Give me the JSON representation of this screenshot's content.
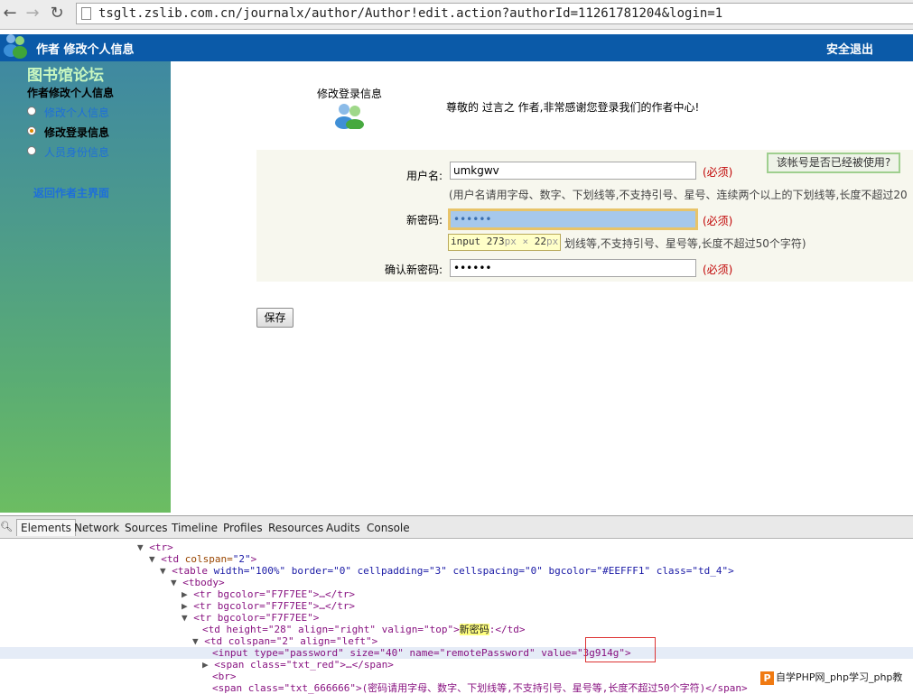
{
  "browser": {
    "url": "tsglt.zslib.com.cn/journalx/author/Author!edit.action?authorId=11261781204&login=1"
  },
  "header": {
    "title": "作者  修改个人信息",
    "logout": "安全退出",
    "bg_color": "#0b5aa8"
  },
  "sidebar": {
    "brand": "图书馆论坛",
    "heading": "作者修改个人信息",
    "items": [
      {
        "label": "修改个人信息",
        "selected": false
      },
      {
        "label": "修改登录信息",
        "selected": true
      },
      {
        "label": "人员身份信息",
        "selected": false
      }
    ],
    "back_link": "返回作者主界面"
  },
  "main": {
    "title": "修改登录信息",
    "welcome": "尊敬的 过言之 作者,非常感谢您登录我们的作者中心!"
  },
  "form": {
    "username_label": "用户名:",
    "username_value": "umkgwv",
    "username_hint": "(用户名请用字母、数字、下划线等,不支持引号、星号、连续两个以上的下划线等,长度不超过20",
    "check_button": "该帐号是否已经被使用?",
    "password_label": "新密码:",
    "password_value": "••••••",
    "password_hint": "划线等,不支持引号、星号等,长度不超过50个字符)",
    "confirm_label": "确认新密码:",
    "confirm_value": "••••••",
    "required": "(必须)",
    "save_button": "保存"
  },
  "tooltip": {
    "element": "input",
    "width": "273",
    "x": "×",
    "height": "22",
    "unit": "px"
  },
  "devtools": {
    "tabs": [
      "Elements",
      "Network",
      "Sources",
      "Timeline",
      "Profiles",
      "Resources",
      "Audits",
      "Console"
    ],
    "active_tab": "Elements",
    "lines": {
      "l1": "<tr>",
      "l2_tag": "<td",
      "l2_a1": " colspan=",
      "l2_v1": "\"2\"",
      "l2_end": ">",
      "l3_tag": "<table",
      "l3_attrs": " width=\"100%\" border=\"0\" cellpadding=\"3\" cellspacing=\"0\" bgcolor=\"#EEFFF1\" class=\"td_4\">",
      "l4": "<tbody>",
      "l5": "<tr bgcolor=\"F7F7EE\">…</tr>",
      "l6": "<tr bgcolor=\"F7F7EE\">…</tr>",
      "l7": "<tr bgcolor=\"F7F7EE\">",
      "l8_tag": "<td height=\"28\" align=\"right\" valign=\"top\">",
      "l8_text": "新密码",
      "l8_end": ":</td>",
      "l9": "<td colspan=\"2\" align=\"left\">",
      "l10_tag": "<input type=\"password\" size=\"40\" name=\"remotePassword\" valu",
      "l10_val": "e=\"3g914g\">",
      "l11": "<span class=\"txt_red\">…</span>",
      "l12": "<br>",
      "l13": "<span class=\"txt_666666\">(密码请用字母、数字、下划线等,不支持引号、星号等,长度不超过50个字符)</span>"
    }
  },
  "watermark": {
    "logo": "P",
    "text": "自学PHP网_php学习_php教"
  }
}
